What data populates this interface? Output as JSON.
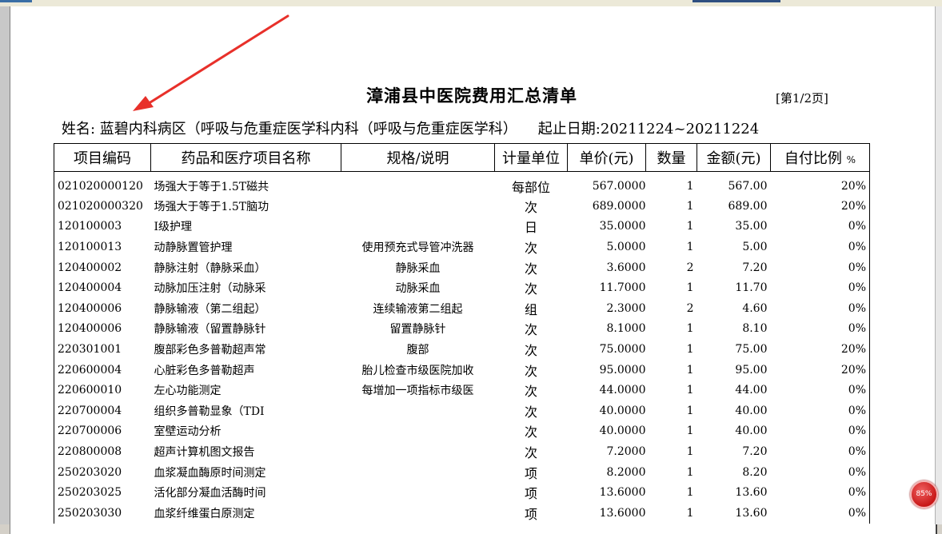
{
  "document": {
    "title": "漳浦县中医院费用汇总清单",
    "page_indicator": "[第1/2页]",
    "name_label": "姓名: 蓝碧",
    "department": "内科病区（呼吸与危重症医学科内科（呼吸与危重症医学科）",
    "date_range_label": "起止日期:",
    "date_range": "20211224~20211224"
  },
  "table": {
    "headers": [
      "项目编码",
      "药品和医疗项目名称",
      "规格/说明",
      "计量单位",
      "单价(元)",
      "数量",
      "金额(元)",
      "自付比例"
    ],
    "ratio_unit": "%",
    "rows": [
      {
        "code": "021020000120",
        "name": "场强大于等于1.5T磁共",
        "spec": "",
        "unit": "每部位",
        "price": "567.0000",
        "qty": "1",
        "amount": "567.00",
        "ratio": "20%"
      },
      {
        "code": "021020000320",
        "name": "场强大于等于1.5T脑功",
        "spec": "",
        "unit": "次",
        "price": "689.0000",
        "qty": "1",
        "amount": "689.00",
        "ratio": "20%"
      },
      {
        "code": "120100003",
        "name": "Ⅰ级护理",
        "spec": "",
        "unit": "日",
        "price": "35.0000",
        "qty": "1",
        "amount": "35.00",
        "ratio": "0%"
      },
      {
        "code": "120100013",
        "name": "动静脉置管护理",
        "spec": "使用预充式导管冲洗器",
        "unit": "次",
        "price": "5.0000",
        "qty": "1",
        "amount": "5.00",
        "ratio": "0%"
      },
      {
        "code": "120400002",
        "name": "静脉注射（静脉采血）",
        "spec": "静脉采血",
        "unit": "次",
        "price": "3.6000",
        "qty": "2",
        "amount": "7.20",
        "ratio": "0%"
      },
      {
        "code": "120400004",
        "name": "动脉加压注射（动脉采",
        "spec": "动脉采血",
        "unit": "次",
        "price": "11.7000",
        "qty": "1",
        "amount": "11.70",
        "ratio": "0%"
      },
      {
        "code": "120400006",
        "name": "静脉输液（第二组起）",
        "spec": "连续输液第二组起",
        "unit": "组",
        "price": "2.3000",
        "qty": "2",
        "amount": "4.60",
        "ratio": "0%"
      },
      {
        "code": "120400006",
        "name": "静脉输液（留置静脉针",
        "spec": "留置静脉针",
        "unit": "次",
        "price": "8.1000",
        "qty": "1",
        "amount": "8.10",
        "ratio": "0%"
      },
      {
        "code": "220301001",
        "name": "腹部彩色多普勒超声常",
        "spec": "腹部",
        "unit": "次",
        "price": "75.0000",
        "qty": "1",
        "amount": "75.00",
        "ratio": "20%"
      },
      {
        "code": "220600004",
        "name": "心脏彩色多普勒超声",
        "spec": "胎儿检查市级医院加收",
        "unit": "次",
        "price": "95.0000",
        "qty": "1",
        "amount": "95.00",
        "ratio": "20%"
      },
      {
        "code": "220600010",
        "name": "左心功能测定",
        "spec": "每增加一项指标市级医",
        "unit": "次",
        "price": "44.0000",
        "qty": "1",
        "amount": "44.00",
        "ratio": "0%"
      },
      {
        "code": "220700004",
        "name": "组织多普勒显象（TDI",
        "spec": "",
        "unit": "次",
        "price": "40.0000",
        "qty": "1",
        "amount": "40.00",
        "ratio": "0%"
      },
      {
        "code": "220700006",
        "name": "室壁运动分析",
        "spec": "",
        "unit": "次",
        "price": "40.0000",
        "qty": "1",
        "amount": "40.00",
        "ratio": "0%"
      },
      {
        "code": "220800008",
        "name": "超声计算机图文报告",
        "spec": "",
        "unit": "次",
        "price": "7.2000",
        "qty": "1",
        "amount": "7.20",
        "ratio": "0%"
      },
      {
        "code": "250203020",
        "name": "血浆凝血酶原时间测定",
        "spec": "",
        "unit": "项",
        "price": "8.2000",
        "qty": "1",
        "amount": "8.20",
        "ratio": "0%"
      },
      {
        "code": "250203025",
        "name": "活化部分凝血活酶时间",
        "spec": "",
        "unit": "项",
        "price": "13.6000",
        "qty": "1",
        "amount": "13.60",
        "ratio": "0%"
      },
      {
        "code": "250203030",
        "name": "血浆纤维蛋白原测定",
        "spec": "",
        "unit": "项",
        "price": "13.6000",
        "qty": "1",
        "amount": "13.60",
        "ratio": "0%"
      }
    ]
  },
  "zoom": {
    "label": "85%"
  },
  "colors": {
    "annotation_arrow": "#e8302a",
    "zoom_badge": "#d02020"
  }
}
